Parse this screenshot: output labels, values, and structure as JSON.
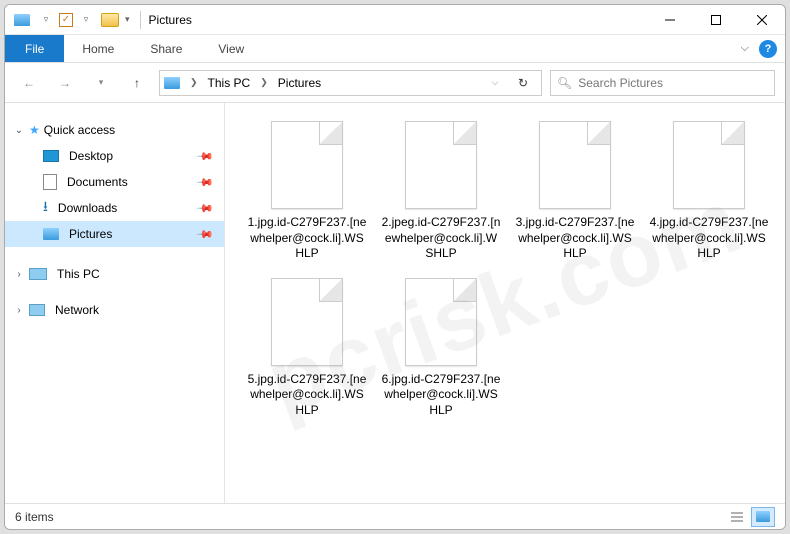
{
  "window": {
    "title": "Pictures"
  },
  "ribbon": {
    "file": "File",
    "tabs": [
      "Home",
      "Share",
      "View"
    ]
  },
  "breadcrumb": {
    "segments": [
      "This PC",
      "Pictures"
    ]
  },
  "search": {
    "placeholder": "Search Pictures"
  },
  "sidebar": {
    "quick_access": "Quick access",
    "items": [
      {
        "label": "Desktop",
        "icon": "desktop"
      },
      {
        "label": "Documents",
        "icon": "documents"
      },
      {
        "label": "Downloads",
        "icon": "downloads"
      },
      {
        "label": "Pictures",
        "icon": "pictures",
        "selected": true
      }
    ],
    "this_pc": "This PC",
    "network": "Network"
  },
  "files": [
    {
      "name": "1.jpg.id-C279F237.[newhelper@cock.li].WSHLP"
    },
    {
      "name": "2.jpeg.id-C279F237.[newhelper@cock.li].WSHLP"
    },
    {
      "name": "3.jpg.id-C279F237.[newhelper@cock.li].WSHLP"
    },
    {
      "name": "4.jpg.id-C279F237.[newhelper@cock.li].WSHLP"
    },
    {
      "name": "5.jpg.id-C279F237.[newhelper@cock.li].WSHLP"
    },
    {
      "name": "6.jpg.id-C279F237.[newhelper@cock.li].WSHLP"
    }
  ],
  "status": {
    "count": "6 items"
  },
  "watermark": "pcrisk.com"
}
